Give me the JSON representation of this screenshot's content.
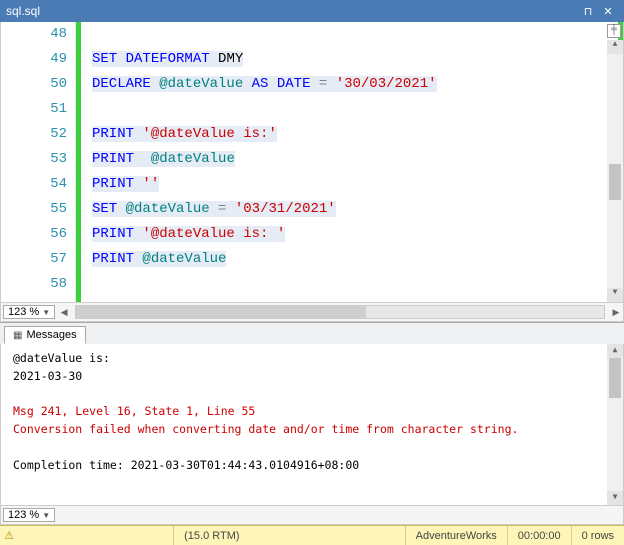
{
  "titlebar": {
    "filename": "sql.sql",
    "pin": "⊓",
    "close": "✕"
  },
  "editor": {
    "zoom": "123 %",
    "lines": [
      {
        "n": 48,
        "tokens": []
      },
      {
        "n": 49,
        "tokens": [
          [
            "kw",
            "SET"
          ],
          [
            "txt",
            " "
          ],
          [
            "kw",
            "DATEFORMAT"
          ],
          [
            "txt",
            " DMY"
          ]
        ],
        "hl": true
      },
      {
        "n": 50,
        "tokens": [
          [
            "kw",
            "DECLARE"
          ],
          [
            "txt",
            " "
          ],
          [
            "var",
            "@dateValue"
          ],
          [
            "txt",
            " "
          ],
          [
            "kw",
            "AS"
          ],
          [
            "txt",
            " "
          ],
          [
            "ty",
            "DATE"
          ],
          [
            "txt",
            " "
          ],
          [
            "op",
            "="
          ],
          [
            "txt",
            " "
          ],
          [
            "str",
            "'30/03/2021'"
          ]
        ],
        "hl": true
      },
      {
        "n": 51,
        "tokens": []
      },
      {
        "n": 52,
        "tokens": [
          [
            "kw",
            "PRINT"
          ],
          [
            "txt",
            " "
          ],
          [
            "str",
            "'@dateValue is:'"
          ]
        ],
        "hl": true
      },
      {
        "n": 53,
        "tokens": [
          [
            "kw",
            "PRINT"
          ],
          [
            "txt",
            "  "
          ],
          [
            "var",
            "@dateValue"
          ]
        ],
        "hl": true
      },
      {
        "n": 54,
        "tokens": [
          [
            "kw",
            "PRINT"
          ],
          [
            "txt",
            " "
          ],
          [
            "str",
            "''"
          ]
        ],
        "hl": true
      },
      {
        "n": 55,
        "tokens": [
          [
            "kw",
            "SET"
          ],
          [
            "txt",
            " "
          ],
          [
            "var",
            "@dateValue"
          ],
          [
            "txt",
            " "
          ],
          [
            "op",
            "="
          ],
          [
            "txt",
            " "
          ],
          [
            "str",
            "'03/31/2021'"
          ]
        ],
        "hl": true
      },
      {
        "n": 56,
        "tokens": [
          [
            "kw",
            "PRINT"
          ],
          [
            "txt",
            " "
          ],
          [
            "str",
            "'@dateValue is: '"
          ]
        ],
        "hl": true
      },
      {
        "n": 57,
        "tokens": [
          [
            "kw",
            "PRINT"
          ],
          [
            "txt",
            " "
          ],
          [
            "var",
            "@dateValue"
          ]
        ],
        "hl": true
      },
      {
        "n": 58,
        "tokens": []
      }
    ]
  },
  "output": {
    "tab": "Messages",
    "zoom": "123 %",
    "lines": [
      "  @dateValue is:",
      "  2021-03-30",
      "",
      "  Msg 241, Level 16, State 1, Line 55",
      "  Conversion failed when converting date and/or time from character string.",
      "",
      "  Completion time: 2021-03-30T01:44:43.0104916+08:00"
    ],
    "errline_idx": [
      3,
      4
    ]
  },
  "status": {
    "version": "(15.0 RTM)",
    "database": "AdventureWorks",
    "time": "00:00:00",
    "rows": "0 rows"
  }
}
